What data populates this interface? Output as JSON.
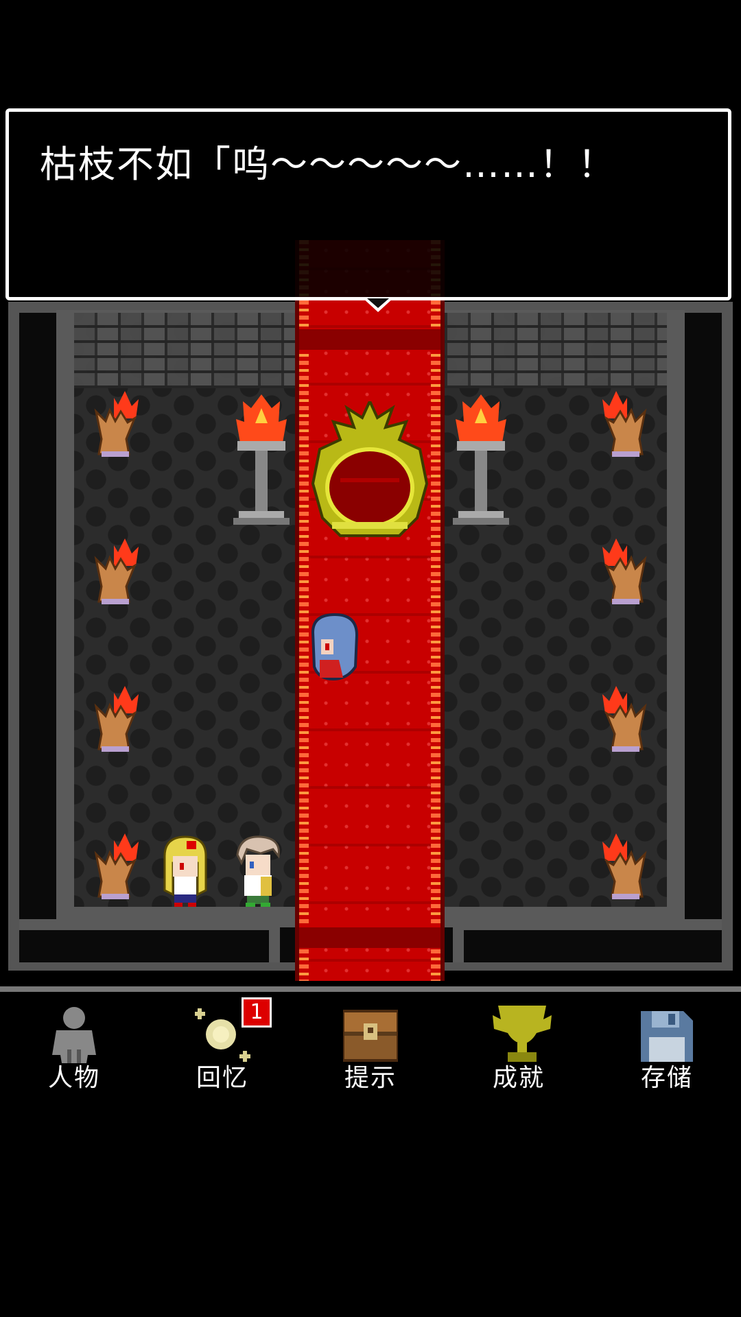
{
  "dialog": {
    "text": "枯枝不如「呜～～～～～……！！"
  },
  "menu": {
    "items": [
      {
        "label": "人物",
        "icon": "person-icon"
      },
      {
        "label": "回忆",
        "icon": "memory-sparkle-icon",
        "badge": "1"
      },
      {
        "label": "提示",
        "icon": "treasure-chest-icon"
      },
      {
        "label": "成就",
        "icon": "trophy-icon"
      },
      {
        "label": "存储",
        "icon": "floppy-disk-icon"
      }
    ]
  },
  "colors": {
    "carpet": "#c80000",
    "badge": "#dd0000",
    "floor": "#2c2c2c",
    "wall_frame": "#5a5a5a"
  }
}
